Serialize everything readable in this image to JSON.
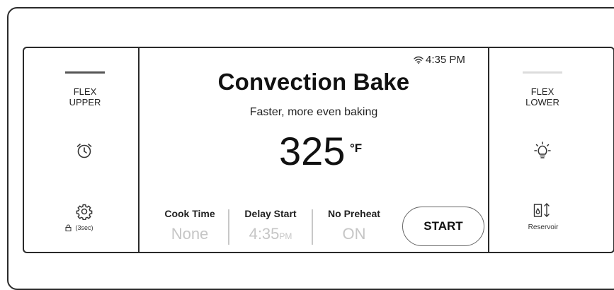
{
  "left": {
    "label_line1": "FLEX",
    "label_line2": "UPPER",
    "lock_text": "(3sec)",
    "icons": [
      "alarm-clock-icon",
      "gear-icon",
      "lock-icon"
    ]
  },
  "right": {
    "label_line1": "FLEX",
    "label_line2": "LOWER",
    "reservoir_text": "Reservoir",
    "icons": [
      "oven-light-icon",
      "water-reservoir-icon"
    ]
  },
  "status": {
    "time": "4:35 PM",
    "icon": "wifi-icon"
  },
  "main": {
    "title": "Convection Bake",
    "subtitle": "Faster, more even baking",
    "temperature": "325",
    "unit": "°F"
  },
  "options": [
    {
      "label": "Cook Time",
      "value": "None",
      "suffix": ""
    },
    {
      "label": "Delay Start",
      "value": "4:35",
      "suffix": "PM"
    },
    {
      "label": "No Preheat",
      "value": "ON",
      "suffix": ""
    }
  ],
  "start_label": "START",
  "colors": {
    "border": "#2a2a2a",
    "dim_text": "#c6c6c6",
    "active_bar": "#555555",
    "inactive_bar": "#dcdcdc"
  }
}
